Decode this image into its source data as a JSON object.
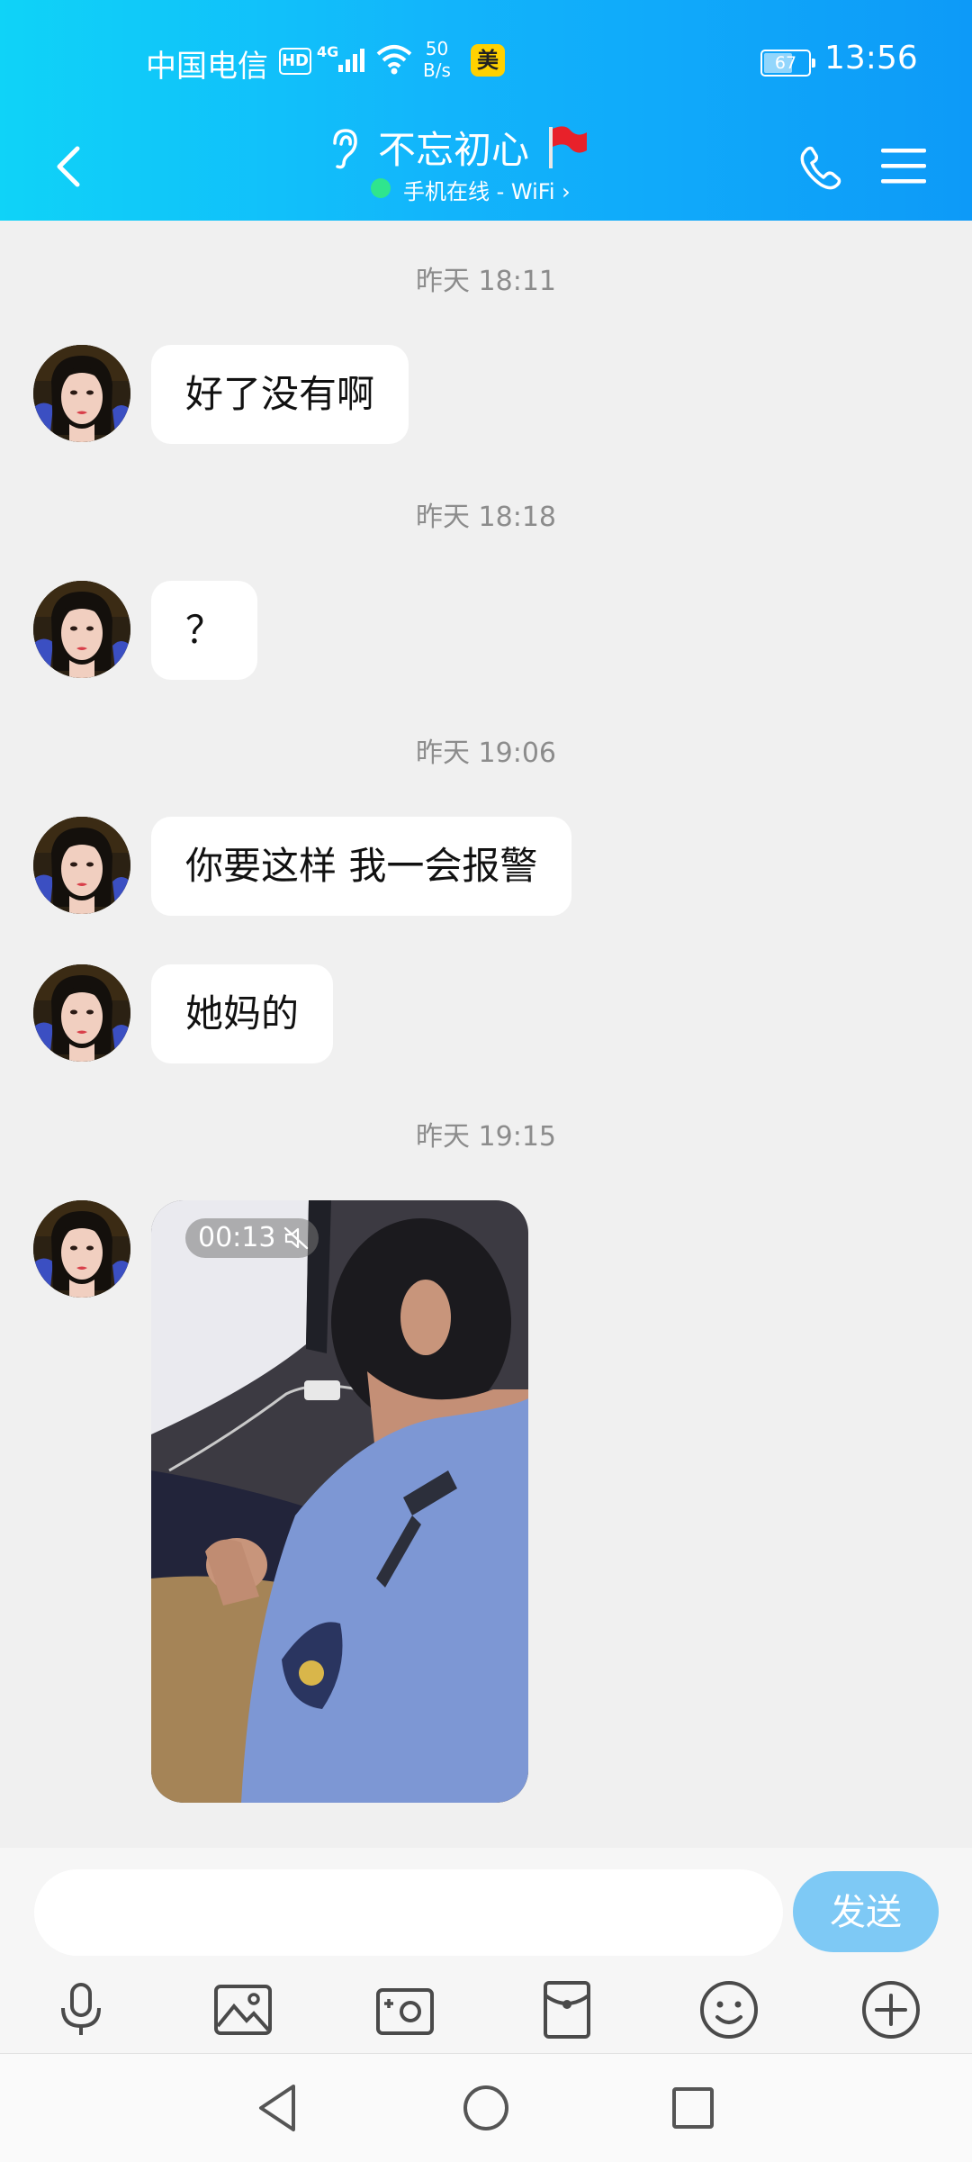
{
  "status_bar": {
    "carrier": "中国电信",
    "hd_badge": "HD",
    "network_type": "4G",
    "speed_value": "50",
    "speed_unit": "B/s",
    "app_badge": "美",
    "battery": "67",
    "battery_level": 0.67,
    "time": "13:56"
  },
  "title_bar": {
    "contact_name": "不忘初心",
    "status": "手机在线 - WiFi",
    "status_arrow": "›"
  },
  "messages": [
    {
      "type": "timestamp",
      "text": "昨天 18:11"
    },
    {
      "type": "text",
      "text": "好了没有啊"
    },
    {
      "type": "timestamp",
      "text": "昨天 18:18"
    },
    {
      "type": "text",
      "text": "？"
    },
    {
      "type": "timestamp",
      "text": "昨天 19:06"
    },
    {
      "type": "text",
      "text": "你要这样 我一会报警"
    },
    {
      "type": "text",
      "text": "她妈的"
    },
    {
      "type": "timestamp",
      "text": "昨天 19:15"
    },
    {
      "type": "video",
      "duration": "00:13"
    }
  ],
  "input": {
    "placeholder": "",
    "value": "",
    "send_label": "发送"
  },
  "toolbar": [
    "microphone-icon",
    "image-icon",
    "camera-icon",
    "red-packet-icon",
    "emoji-icon",
    "plus-icon"
  ],
  "colors": {
    "header_start": "#0fd3f8",
    "header_end": "#0d9af8",
    "send_button": "#7ec9f5",
    "online_dot": "#2fe58e",
    "chat_bg": "#f0f0f0"
  }
}
